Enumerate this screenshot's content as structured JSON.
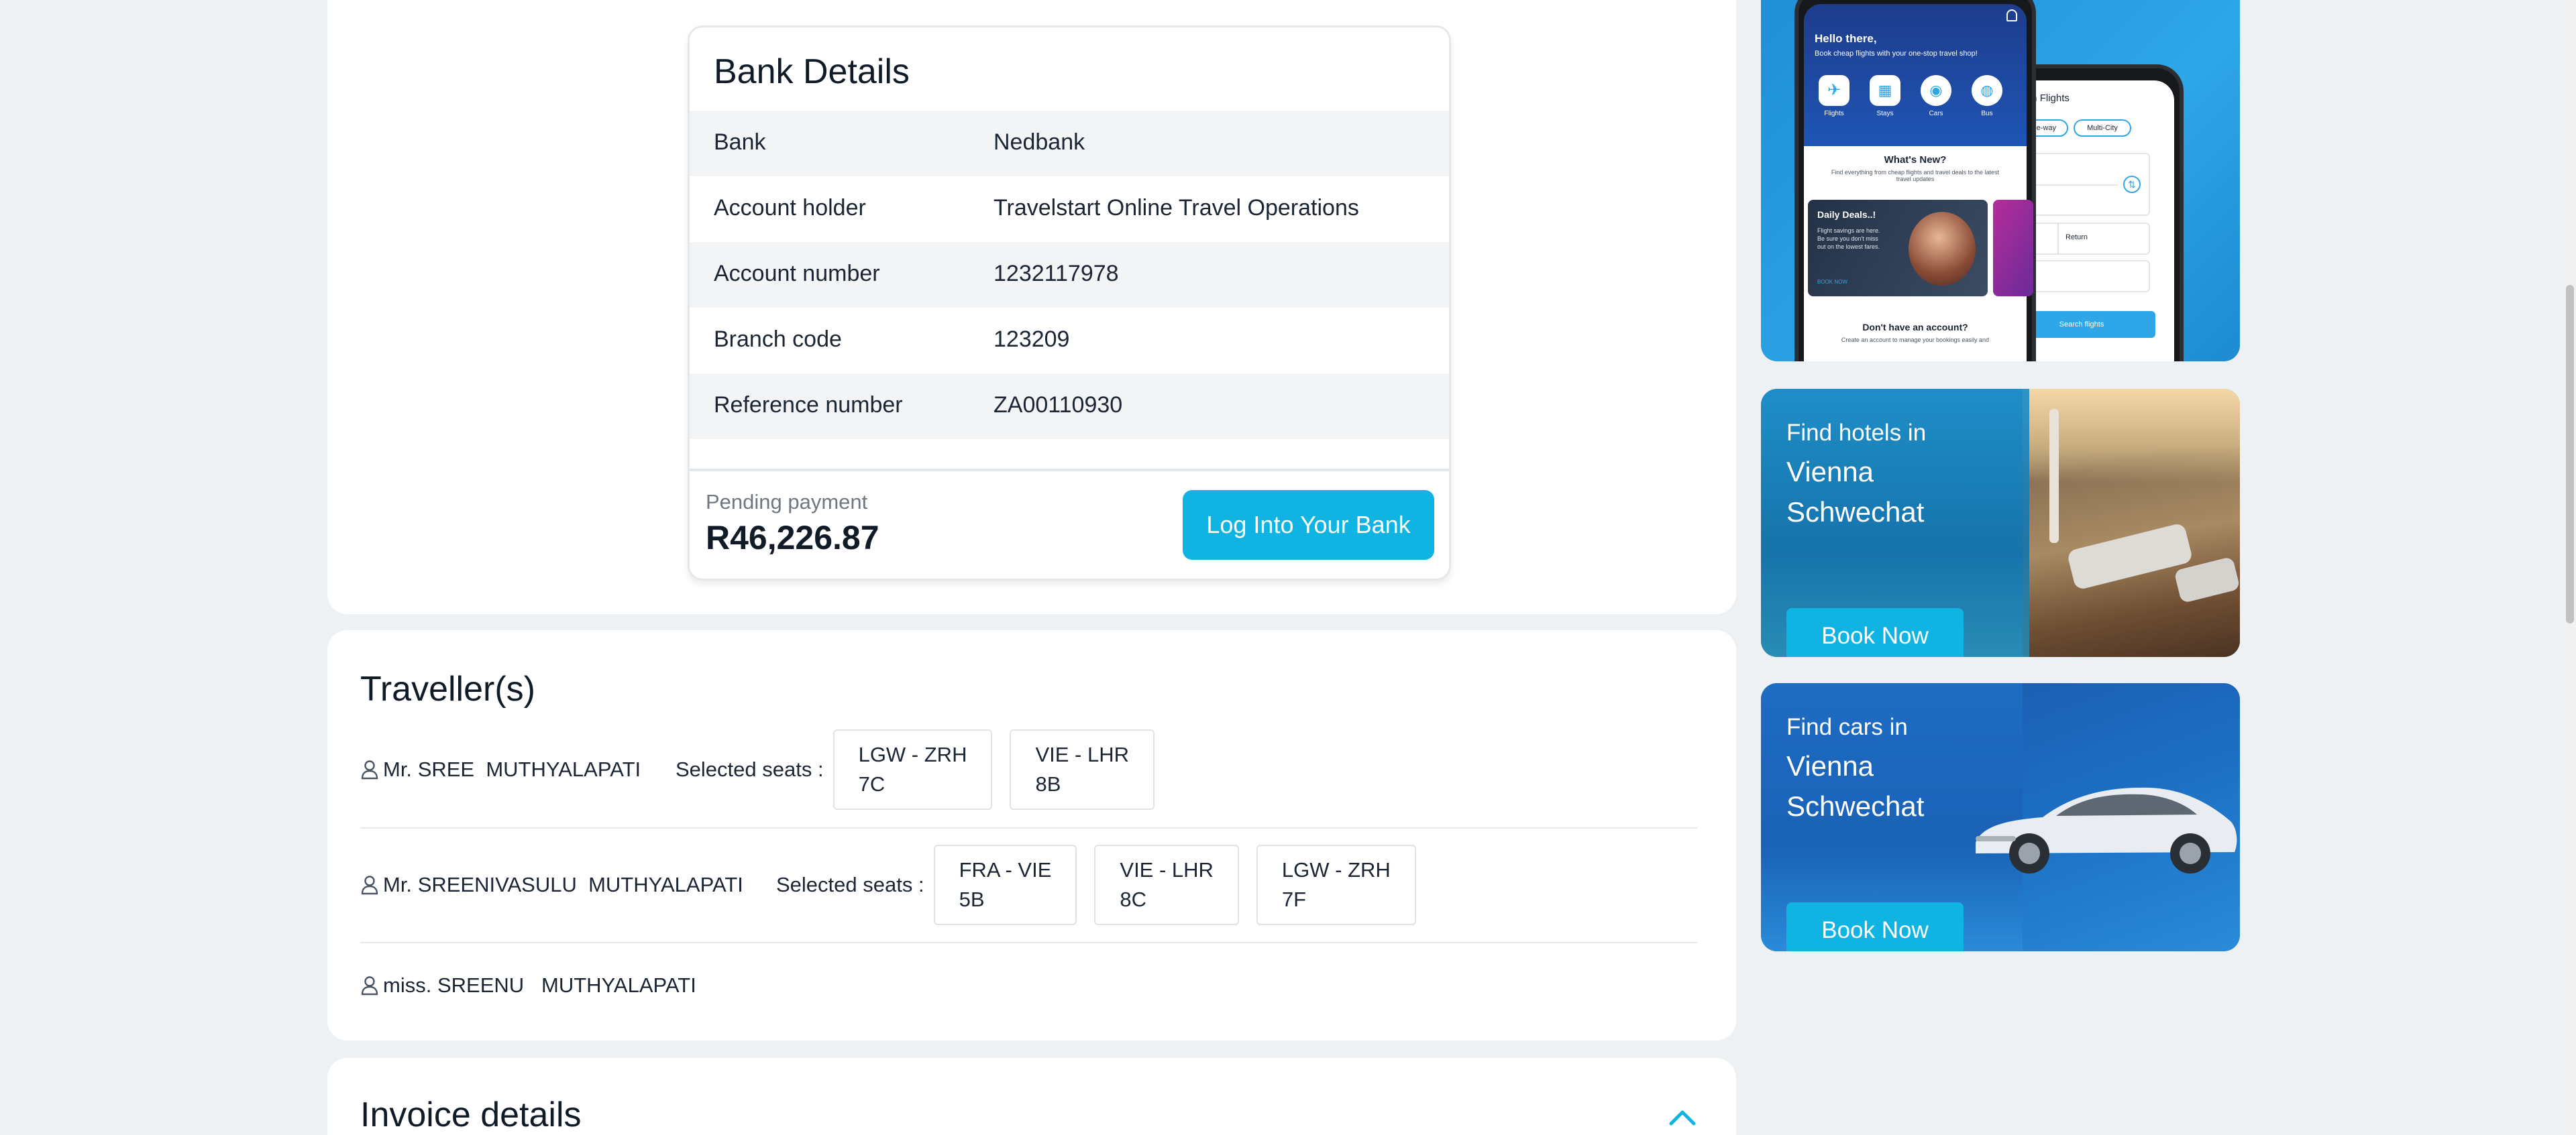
{
  "bank": {
    "title": "Bank Details",
    "rows": [
      {
        "label": "Bank",
        "value": "Nedbank"
      },
      {
        "label": "Account holder",
        "value": "Travelstart Online Travel Operations"
      },
      {
        "label": "Account number",
        "value": "1232117978"
      },
      {
        "label": "Branch code",
        "value": "123209"
      },
      {
        "label": "Reference number",
        "value": "ZA00110930"
      }
    ],
    "pending_label": "Pending payment",
    "pending_amount": "R46,226.87",
    "login_label": "Log Into Your Bank"
  },
  "travellers": {
    "title": "Traveller(s)",
    "seats_label": "Selected seats :",
    "list": [
      {
        "title": "Mr.",
        "first": "SREE",
        "last": "MUTHYALAPATI",
        "seats": [
          {
            "route": "LGW - ZRH",
            "seat": "7C"
          },
          {
            "route": "VIE - LHR",
            "seat": "8B"
          }
        ]
      },
      {
        "title": "Mr.",
        "first": "SREENIVASULU",
        "last": "MUTHYALAPATI",
        "seats": [
          {
            "route": "FRA - VIE",
            "seat": "5B"
          },
          {
            "route": "VIE - LHR",
            "seat": "8C"
          },
          {
            "route": "LGW - ZRH",
            "seat": "7F"
          }
        ]
      },
      {
        "title": "miss.",
        "first": "SREENU",
        "last": "MUTHYALAPATI",
        "seats": []
      }
    ]
  },
  "invoice": {
    "title": "Invoice details"
  },
  "promos": {
    "app": {
      "greeting": "Hello there,",
      "tagline": "Book cheap flights with your one-stop travel shop!",
      "icons": [
        "Flights",
        "Stays",
        "Cars",
        "Bus"
      ],
      "whats_new": "What's New?",
      "whats_new_sub": "Find everything from cheap flights and travel deals to the latest travel updates",
      "deal_title": "Daily Deals..!",
      "deal_text": "Flight savings are here. Be sure you don't miss out on the lowest fares.",
      "deal_cta": "BOOK NOW",
      "no_account": "Don't have an account?",
      "no_account_sub": "Create an account to manage your bookings easily and",
      "search_title": "Search Flights",
      "trip_one_way": "One-way",
      "trip_multi": "Multi-City",
      "return_label": "Return",
      "search_btn": "Search flights"
    },
    "hotels": {
      "line1": "Find hotels in",
      "city1": "Vienna",
      "city2": "Schwechat",
      "button": "Book Now"
    },
    "cars": {
      "line1": "Find cars in",
      "city1": "Vienna",
      "city2": "Schwechat",
      "button": "Book Now"
    }
  },
  "colors": {
    "accent": "#0fb4e3",
    "background": "#eef1f3"
  }
}
